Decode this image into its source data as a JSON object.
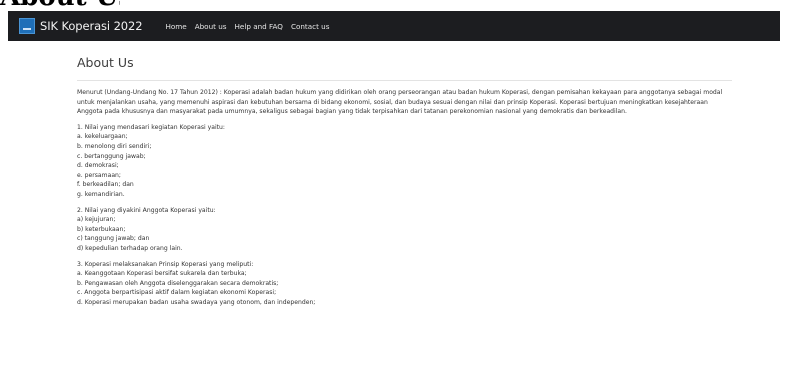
{
  "page_heading_fragment": "About Us",
  "navbar": {
    "brand": "SIK Koperasi 2022",
    "links": [
      "Home",
      "About us",
      "Help and FAQ",
      "Contact us"
    ]
  },
  "main": {
    "title": "About Us",
    "intro": "Menurut (Undang-Undang No. 17 Tahun 2012) : Koperasi adalah badan hukum yang didirikan oleh orang perseorangan atau badan hukum Koperasi, dengan pemisahan kekayaan para anggotanya sebagai modal untuk menjalankan usaha, yang memenuhi aspirasi dan kebutuhan bersama di bidang ekonomi, sosial, dan budaya sesuai dengan nilai dan prinsip Koperasi. Koperasi bertujuan meningkatkan kesejahteraan Anggota pada khususnya dan masyarakat pada umumnya, sekaligus sebagai bagian yang tidak terpisahkan dari tatanan perekonomian nasional yang demokratis dan berkeadilan.",
    "section1": {
      "heading": "1. Nilai yang mendasari kegiatan Koperasi yaitu:",
      "items": [
        "a. kekeluargaan;",
        "b. menolong diri sendiri;",
        "c. bertanggung jawab;",
        "d. demokrasi;",
        "e. persamaan;",
        "f. berkeadilan; dan",
        "g. kemandirian."
      ]
    },
    "section2": {
      "heading": "2. Nilai yang diyakini Anggota Koperasi yaitu:",
      "items": [
        "a) kejujuran;",
        "b) keterbukaan;",
        "c) tanggung jawab; dan",
        "d) kepedulian terhadap orang lain."
      ]
    },
    "section3": {
      "heading": "3. Koperasi melaksanakan Prinsip Koperasi yang meliputi:",
      "items": [
        "a. Keanggotaan Koperasi bersifat sukarela dan terbuka;",
        "b. Pengawasan oleh Anggota diselenggarakan secara demokratis;",
        "c. Anggota berpartisipasi aktif dalam kegiatan ekonomi Koperasi;",
        "d. Koperasi merupakan badan usaha swadaya yang otonom, dan independen;"
      ]
    }
  }
}
